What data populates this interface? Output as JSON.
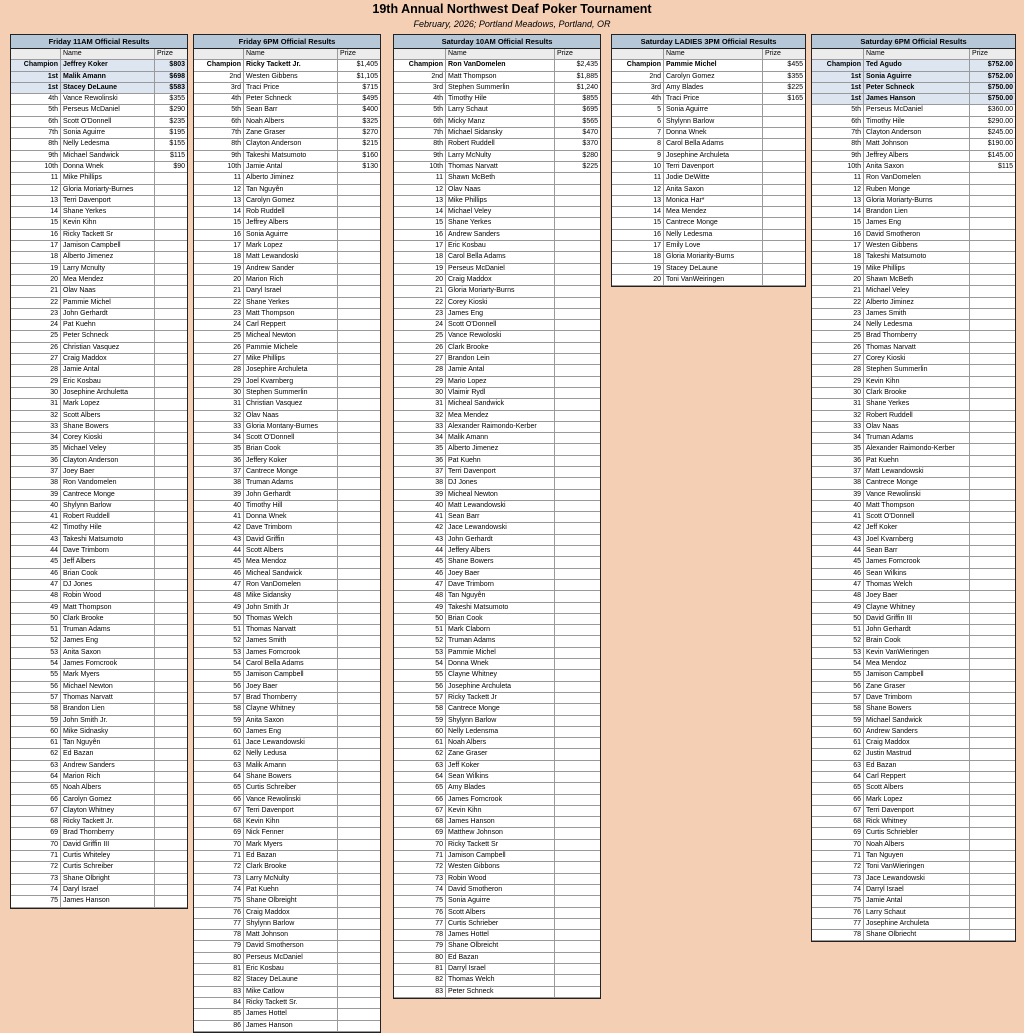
{
  "title": "19th Annual Northwest Deaf Poker Tournament",
  "subtitle": "February, 2026; Portland Meadows, Portland, OR",
  "header_labels": {
    "name": "Name",
    "prize": "Prize"
  },
  "tables": [
    {
      "heading": "Friday 11AM Official Results",
      "results": [
        {
          "place": "Champion",
          "name": "Jeffrey Koker",
          "prize": "$803",
          "hl": true
        },
        {
          "place": "1st",
          "name": "Malik Amann",
          "prize": "$698",
          "hl": true
        },
        {
          "place": "1st",
          "name": "Stacey DeLaune",
          "prize": "$583",
          "hl": true
        },
        {
          "place": "4th",
          "name": "Vance Rewolinski",
          "prize": "$355"
        },
        {
          "place": "5th",
          "name": "Perseus McDaniel",
          "prize": "$290"
        },
        {
          "place": "6th",
          "name": "Scott O'Donnell",
          "prize": "$235"
        },
        {
          "place": "7th",
          "name": "Sonia Aguirre",
          "prize": "$195"
        },
        {
          "place": "8th",
          "name": "Nelly Ledesma",
          "prize": "$155"
        },
        {
          "place": "9th",
          "name": "Michael Sandwick",
          "prize": "$115"
        },
        {
          "place": "10th",
          "name": "Donna Wnek",
          "prize": "$90"
        }
      ],
      "start_number": 11,
      "others": [
        "Mike Phillips",
        "Gloria Moriarty-Burnes",
        "Terri Davenport",
        "Shane Yerkes",
        "Kevin Kihn",
        "Ricky Tackett Sr",
        "Jamison Campbell",
        "Alberto Jimenez",
        "Larry Mcnulty",
        "Mea Mendez",
        "Olav Naas",
        "Pammie Michel",
        "John Gerhardt",
        "Pat Kuehn",
        "Peter Schneck",
        "Christian Vasquez",
        "Craig Maddox",
        "Jamie Antal",
        "Eric Kosbau",
        "Josephine Archuletta",
        "Mark Lopez",
        "Scott Albers",
        "Shane Bowers",
        "Corey Kioski",
        "Michael Veley",
        "Clayton Anderson",
        "Joey Baer",
        "Ron Vandomelen",
        "Cantrece Monge",
        "Shylynn Barlow",
        "Robert Ruddell",
        "Timothy Hile",
        "Takeshi Matsumoto",
        "Dave Trimborn",
        "Jeff Albers",
        "Brian Cook",
        "DJ Jones",
        "Robin Wood",
        "Matt Thompson",
        "Clark Brooke",
        "Truman Adams",
        "James Eng",
        "Anita Saxon",
        "James Forncrook",
        "Mark Myers",
        "Michael Newton",
        "Thomas Narvatt",
        "Brandon Lien",
        "John Smith Jr.",
        "Mike Sidnasky",
        "Tan Nguyễn",
        "Ed Bazan",
        "Andrew Sanders",
        "Marion Rich",
        "Noah Albers",
        "Carolyn Gomez",
        "Clayton Whitney",
        "Ricky Tackett Jr.",
        "Brad Thornberry",
        "David Griffin III",
        "Curtis Whiteley",
        "Curtis Schreiber",
        "Shane Olbright",
        "Daryl Israel",
        "James Hanson"
      ]
    },
    {
      "heading": "Friday 6PM Official Results",
      "results": [
        {
          "place": "Champion",
          "name": "Ricky Tackett Jr.",
          "prize": "$1,405"
        },
        {
          "place": "2nd",
          "name": "Westen Gibbens",
          "prize": "$1,105"
        },
        {
          "place": "3rd",
          "name": "Traci Price",
          "prize": "$715"
        },
        {
          "place": "4th",
          "name": "Peter Schneck",
          "prize": "$495"
        },
        {
          "place": "5th",
          "name": "Sean Barr",
          "prize": "$400"
        },
        {
          "place": "6th",
          "name": "Noah Albers",
          "prize": "$325"
        },
        {
          "place": "7th",
          "name": "Zane Graser",
          "prize": "$270"
        },
        {
          "place": "8th",
          "name": "Clayton Anderson",
          "prize": "$215"
        },
        {
          "place": "9th",
          "name": "Takeshi Matsumoto",
          "prize": "$160"
        },
        {
          "place": "10th",
          "name": "Jamie Antal",
          "prize": "$130"
        }
      ],
      "start_number": 11,
      "others": [
        "Alberto Jiminez",
        "Tan Nguyễn",
        "Carolyn Gomez",
        "Rob Ruddell",
        "Jeffrey Albers",
        "Sonia Aguirre",
        "Mark Lopez",
        "Matt Lewandoski",
        "Andrew Sander",
        "Marion Rich",
        "Daryl Israel",
        "Shane Yerkes",
        "Matt Thompson",
        "Carl Reppert",
        "Micheal Newton",
        "Pammie Michele",
        "Mike Phillips",
        "Josephire Archuleta",
        "Joel Kvarnberg",
        "Stephen Summerlin",
        "Christian Vasquez",
        "Olav Naas",
        "Gloria Montany-Burnes",
        "Scott O'Donnell",
        "Brian Cook",
        "Jeffery Koker",
        "Cantrece Monge",
        "Truman Adams",
        "John Gerhardt",
        "Timothy Hill",
        "Donna Wnek",
        "Dave Trimborn",
        "David Griffin",
        "Scott Albers",
        "Mea Mendoz",
        "Micheal Sandwick",
        "Ron VanDomelen",
        "Mike Sidansky",
        "John Smith Jr",
        "Thomas Welch",
        "Thomas Narvatt",
        "James Smith",
        "James Forncrook",
        "Carol Bella Adams",
        "Jamison Campbell",
        "Joey Baer",
        "Brad Thornberry",
        "Clayne Whitney",
        "Anita Saxon",
        "James Eng",
        "Jace Lewandowski",
        "Nelly Ledusa",
        "Malik Amann",
        "Shane Bowers",
        "Curtis Schreiber",
        "Vance Rewolinski",
        "Terri Davenport",
        "Kevin Kihn",
        "Nick Fenner",
        "Mark Myers",
        "Ed Bazan",
        "Clark Brooke",
        "Larry McNulty",
        "Pat Kuehn",
        "Shane Olbreight",
        "Craig Maddox",
        "Shylynn Barlow",
        "Matt Johnson",
        "David Smotherson",
        "Perseus McDaniel",
        "Eric Kosbau",
        "Stacey DeLaune",
        "Mike Catlow",
        "Ricky Tackett Sr.",
        "James Hottel",
        "James Hanson"
      ]
    },
    {
      "heading": "Saturday 10AM Official Results",
      "results": [
        {
          "place": "Champion",
          "name": "Ron VanDomelen",
          "prize": "$2,435"
        },
        {
          "place": "2nd",
          "name": "Matt Thompson",
          "prize": "$1,885"
        },
        {
          "place": "3rd",
          "name": "Stephen Summerlin",
          "prize": "$1,240"
        },
        {
          "place": "4th",
          "name": "Timothy Hile",
          "prize": "$855"
        },
        {
          "place": "5th",
          "name": "Larry Schaut",
          "prize": "$695"
        },
        {
          "place": "6th",
          "name": "Micky Manz",
          "prize": "$565"
        },
        {
          "place": "7th",
          "name": "Michael Sidansky",
          "prize": "$470"
        },
        {
          "place": "8th",
          "name": "Robert Ruddell",
          "prize": "$370"
        },
        {
          "place": "9th",
          "name": "Larry McNulty",
          "prize": "$280"
        },
        {
          "place": "10th",
          "name": "Thomas Narvatt",
          "prize": "$225"
        }
      ],
      "start_number": 11,
      "others": [
        "Shawn McBeth",
        "Olav Naas",
        "Mike Phillips",
        "Michael Veley",
        "Shane Yerkes",
        "Andrew Sanders",
        "Eric Kosbau",
        "Carol Bella Adams",
        "Perseus McDaniel",
        "Craig Maddox",
        "Gloria Moriarty-Burns",
        "Corey Kioski",
        "James Eng",
        "Scott O'Donnell",
        "Vance Rewoloski",
        "Clark Brooke",
        "Brandon Lein",
        "Jamie Antal",
        "Mario Lopez",
        "Vlaimir Rydl",
        "Micheal Sandwick",
        "Mea Mendez",
        "Alexander Raimondo-Kerber",
        "Malik Amann",
        "Alberto Jimenez",
        "Pat Kuehn",
        "Terri Davenport",
        "DJ Jones",
        "Micheal Newton",
        "Matt Lewandowski",
        "Sean Barr",
        "Jace Lewandowski",
        "John Gerhardt",
        "Jeffery Albers",
        "Shane Bowers",
        "Joey Baer",
        "Dave Trimborn",
        "Tan Nguyễn",
        "Takeshi Matsumoto",
        "Brian Cook",
        "Mark Claborn",
        "Truman Adams",
        "Pammie Michel",
        "Donna Wnek",
        "Clayne Whitney",
        "Josephine Archuleta",
        "Ricky Tackett Jr",
        "Cantrece Monge",
        "Shylynn Barlow",
        "Nelly Ledensma",
        "Noah Albers",
        "Zane Graser",
        "Jeff Koker",
        "Sean Wilkins",
        "Amy Blades",
        "James Forncrook",
        "Kevin Kihn",
        "James Hanson",
        "Matthew Johnson",
        "Ricky Tackett Sr",
        "Jamison Campbell",
        "Westen Gibbons",
        "Robin Wood",
        "David Smotheron",
        "Sonia Aguirre",
        "Scott Albers",
        "Curtis Schrieber",
        "James Hottel",
        "Shane Olbreicht",
        "Ed Bazan",
        "Darryl Israel",
        "Thomas Welch",
        "Peter Schneck"
      ]
    },
    {
      "heading": "Saturday LADIES 3PM Official Results",
      "results": [
        {
          "place": "Champion",
          "name": "Pammie Michel",
          "prize": "$455"
        },
        {
          "place": "2nd",
          "name": "Carolyn Gomez",
          "prize": "$355"
        },
        {
          "place": "3rd",
          "name": "Amy Blades",
          "prize": "$225"
        },
        {
          "place": "4th",
          "name": "Traci Price",
          "prize": "$165"
        }
      ],
      "start_number": 5,
      "others": [
        "Sonia Aguirre",
        "Shylynn Barlow",
        "Donna Wnek",
        "Carol Bella Adams",
        "Josephine Archuleta",
        "Terri Davenport",
        "Jodie DeWitte",
        "Anita Saxon",
        "Monica Har*",
        "Mea Mendez",
        "Cantrece Monge",
        "Nelly Ledesma",
        "Emily Love",
        "Gloria Moriarity-Burns",
        "Stacey DeLaune",
        "Toni VanWeiringen"
      ]
    },
    {
      "heading": "Saturday 6PM Official Results",
      "results": [
        {
          "place": "Champion",
          "name": "Ted Agudo",
          "prize": "$752.00",
          "hl": true
        },
        {
          "place": "1st",
          "name": "Sonia Aguirre",
          "prize": "$752.00",
          "hl": true
        },
        {
          "place": "1st",
          "name": "Peter Schneck",
          "prize": "$750.00",
          "hl": true
        },
        {
          "place": "1st",
          "name": "James Hanson",
          "prize": "$750.00",
          "hl": true
        },
        {
          "place": "5th",
          "name": "Perseus McDaniel",
          "prize": "$360.00"
        },
        {
          "place": "6th",
          "name": "Timothy Hile",
          "prize": "$290.00"
        },
        {
          "place": "7th",
          "name": "Clayton Anderson",
          "prize": "$245.00"
        },
        {
          "place": "8th",
          "name": "Matt Johnson",
          "prize": "$190.00"
        },
        {
          "place": "9th",
          "name": "Jeffrey Albers",
          "prize": "$145.00"
        },
        {
          "place": "10th",
          "name": "Anita Saxon",
          "prize": "$115"
        }
      ],
      "start_number": 11,
      "others": [
        "Ron VanDomelen",
        "Ruben Monge",
        "Gloria Moriarty-Burns",
        "Brandon Lien",
        "James Eng",
        "David Smotheron",
        "Westen Gibbens",
        "Takeshi Matsumoto",
        "Mike Phillips",
        "Shawn McBeth",
        "Michael Veley",
        "Alberto Jiminez",
        "James Smith",
        "Nelly Ledesma",
        "Brad Thornberry",
        "Thomas Narvatt",
        "Corey Kioski",
        "Stephen Summerlin",
        "Kevin Kihn",
        "Clark Brooke",
        "Shane Yerkes",
        "Robert Ruddell",
        "Olav Naas",
        "Truman Adams",
        "Alexander Raimondo-Kerber",
        "Pat Kuehn",
        "Matt Lewandowski",
        "Cantrece Monge",
        "Vance Rewolinski",
        "Matt Thompson",
        "Scott O'Donnell",
        "Jeff Koker",
        "Joel Kvarnberg",
        "Sean Barr",
        "James Forncrook",
        "Sean Wilkins",
        "Thomas Welch",
        "Joey Baer",
        "Clayne Whitney",
        "David Griffin III",
        "John Gerhardt",
        "Brain Cook",
        "Kevin VanWieringen",
        "Mea Mendoz",
        "Jamison Campbell",
        "Zane Graser",
        "Dave Trimborn",
        "Shane Bowers",
        "Michael Sandwick",
        "Andrew Sanders",
        "Craig Maddox",
        "Justin Mastrud",
        "Ed Bazan",
        "Carl Reppert",
        "Scott Albers",
        "Mark Lopez",
        "Terri Davenport",
        "Rick Whitney",
        "Curtis Schriebler",
        "Noah Albers",
        "Tan Nguyen",
        "Toni VanWieringen",
        "Jace Lewandowski",
        "Darryl Israel",
        "Jamie Antal",
        "Larry Schaut",
        "Josephine Archuleta",
        "Shane Olbriecht"
      ]
    }
  ]
}
